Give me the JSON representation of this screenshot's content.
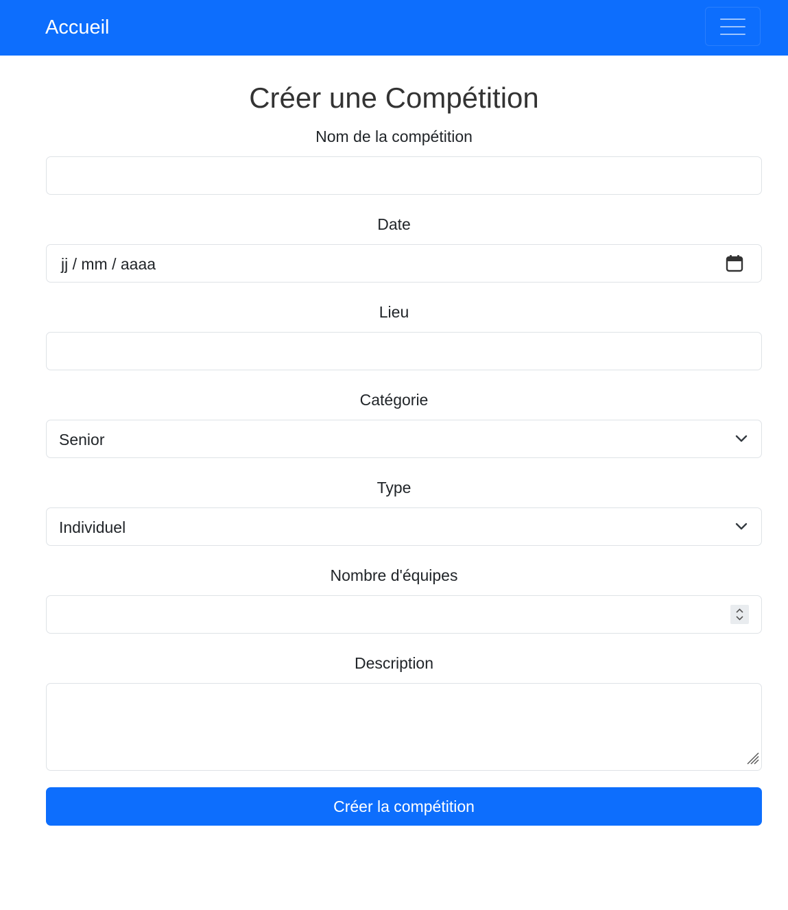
{
  "navbar": {
    "brand": "Accueil",
    "background": "#0d6efd",
    "toggler_icon": "hamburger-menu-icon"
  },
  "page": {
    "title": "Créer une Compétition"
  },
  "form": {
    "name": {
      "label": "Nom de la compétition",
      "value": ""
    },
    "date": {
      "label": "Date",
      "placeholder": "jj / mm / aaaa",
      "icon": "calendar-icon"
    },
    "location": {
      "label": "Lieu",
      "value": ""
    },
    "category": {
      "label": "Catégorie",
      "selected": "Senior",
      "icon": "chevron-down-icon"
    },
    "type": {
      "label": "Type",
      "selected": "Individuel",
      "icon": "chevron-down-icon"
    },
    "team_count": {
      "label": "Nombre d'équipes",
      "value": "",
      "icon": "spinner-arrows-icon"
    },
    "description": {
      "label": "Description",
      "value": ""
    },
    "submit": {
      "label": "Créer la compétition",
      "color": "#0d6efd"
    }
  }
}
